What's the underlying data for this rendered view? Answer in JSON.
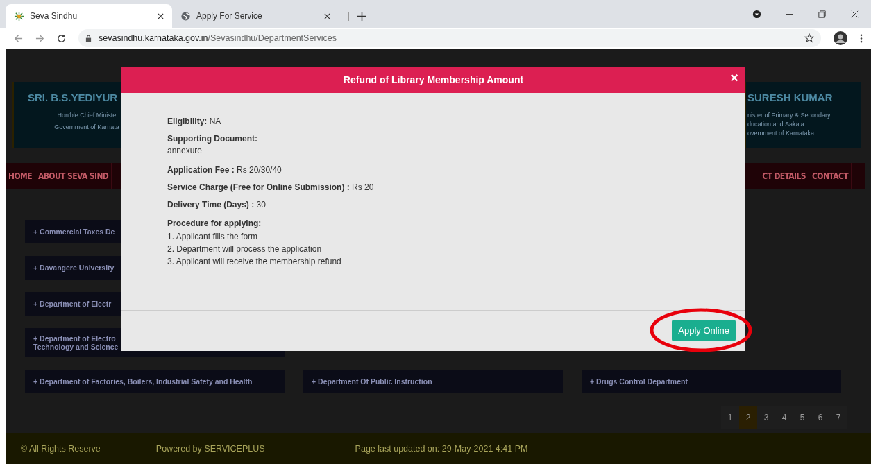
{
  "browser": {
    "tabs": [
      {
        "title": "Seva Sindhu",
        "selected": true
      },
      {
        "title": "Apply For Service",
        "selected": false
      }
    ],
    "url_host": "sevasindhu.karnataka.gov.in",
    "url_path": "/Sevasindhu/DepartmentServices"
  },
  "header": {
    "left_name": "SRI. B.S.YEDIYUR",
    "left_lines": [
      "Hon'ble Chief Ministe",
      "Government of Karnata"
    ],
    "right_name": "SURESH KUMAR",
    "right_lines": [
      "nister of Primary & Secondary",
      "ducation and Sakala",
      "overnment of Karnataka"
    ]
  },
  "nav_left": [
    "HOME",
    "ABOUT SEVA SIND"
  ],
  "nav_right": [
    "CT DETAILS",
    "CONTACT"
  ],
  "departments": [
    [
      "+ Commercial Taxes De",
      "+ Davangere University",
      "+ Department of Electr",
      "+ Department of Electro\nTechnology and Science",
      "+ Department of Factories, Boilers, Industrial Safety and Health"
    ],
    [
      "+ Department Of Public Instruction"
    ],
    [
      "+ Drugs Control Department"
    ]
  ],
  "pagination": [
    {
      "label": "1",
      "selected": false
    },
    {
      "label": "2",
      "selected": true
    },
    {
      "label": "3",
      "selected": false
    },
    {
      "label": "4",
      "selected": false
    },
    {
      "label": "5",
      "selected": false
    },
    {
      "label": "6",
      "selected": false
    },
    {
      "label": "7",
      "selected": false
    }
  ],
  "footer": [
    "© All Rights Reserve",
    "Powered by SERVICEPLUS",
    "Page last updated on: 29-May-2021 4:41 PM"
  ],
  "modal": {
    "title": "Refund of Library Membership Amount",
    "close": "×",
    "details": [
      {
        "kind": "inline",
        "label": "Eligibility:",
        "value": "NA"
      },
      {
        "kind": "block",
        "label": "Supporting Document:",
        "value": "annexure"
      },
      {
        "kind": "inline",
        "label": "Application Fee :",
        "value": "Rs 20/30/40"
      },
      {
        "kind": "inline",
        "label": "Service Charge (Free for Online Submission) :",
        "value": "Rs 20"
      },
      {
        "kind": "inline",
        "label": "Delivery Time (Days) :",
        "value": "30"
      }
    ],
    "procedure_title": "Procedure for applying:",
    "steps": [
      "1. Applicant fills the form",
      "2. Department will process the application",
      "3. Applicant will receive the membership refund"
    ],
    "button": "Apply Online",
    "highlighted": true
  }
}
